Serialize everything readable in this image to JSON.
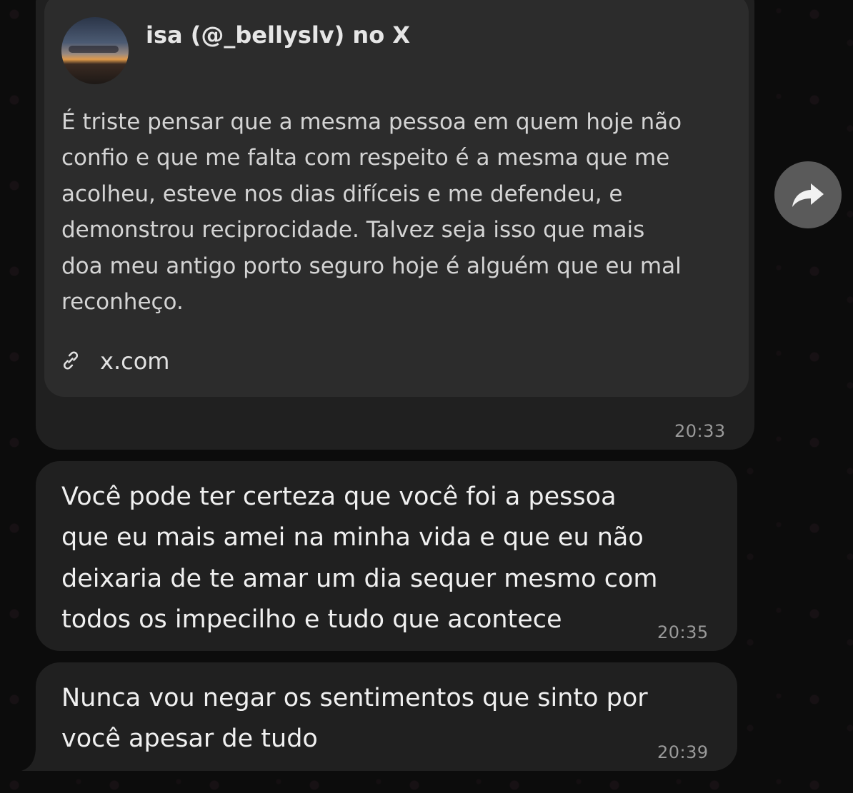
{
  "link_preview": {
    "title": "isa (@_bellyslv) no X",
    "body_lines": [
      "É triste pensar que a mesma pessoa em quem hoje não",
      "confio e que me falta com respeito é a mesma que me",
      "acolheu, esteve nos dias difíceis e me defendeu, e",
      "demonstrou reciprocidade. Talvez seja isso que mais",
      "doa meu antigo porto seguro hoje é alguém que eu mal",
      "reconheço."
    ],
    "link_text": "x.com",
    "link_icon": "link-icon",
    "avatar": "sunset-avatar"
  },
  "messages": [
    {
      "time": "20:33"
    },
    {
      "lines": [
        "Você pode ter certeza que você foi a pessoa",
        "que eu mais amei na minha vida e que eu não",
        "deixaria de te amar um dia sequer mesmo com",
        "todos os impecilho e tudo que acontece"
      ],
      "time": "20:35"
    },
    {
      "lines": [
        "Nunca vou negar os sentimentos que sinto por",
        "você apesar de tudo"
      ],
      "time": "20:39"
    }
  ],
  "forward_button": {
    "icon": "forward-arrow-icon"
  },
  "colors": {
    "background": "#0b0b0b",
    "bubble": "#202020",
    "preview_card": "#2c2c2c",
    "forward_button": "#5a5a5a",
    "timestamp": "#9a9a9a"
  }
}
